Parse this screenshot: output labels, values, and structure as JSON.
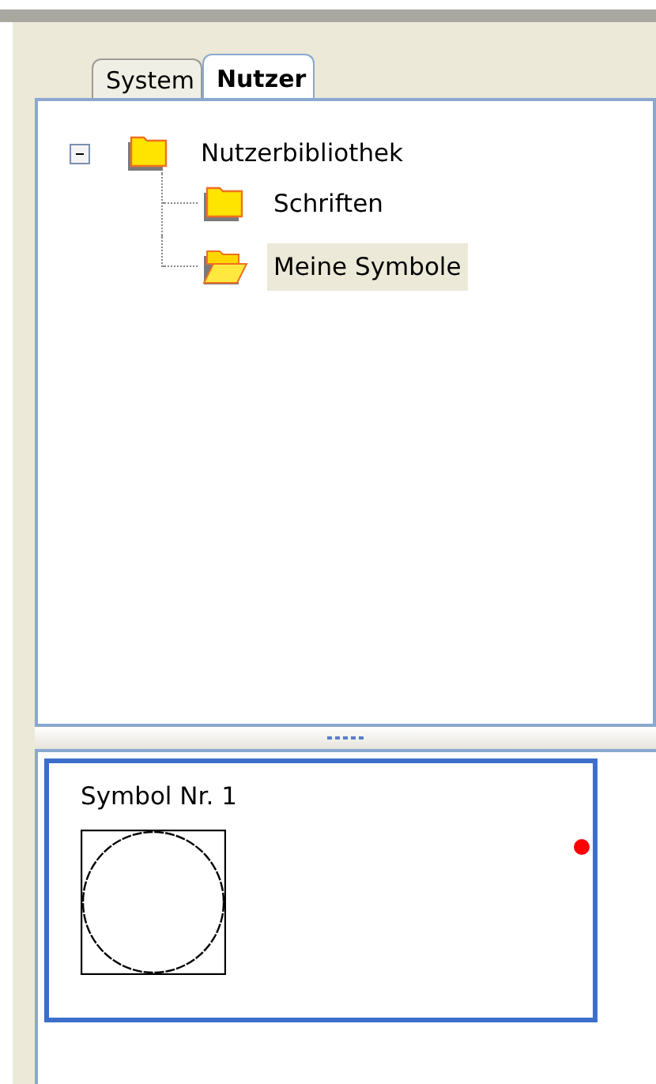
{
  "tabs": [
    {
      "label": "System",
      "selected": false
    },
    {
      "label": "Nutzer",
      "selected": true
    }
  ],
  "tree": [
    {
      "label": "Nutzerbibliothek",
      "expanded": true,
      "selected": false,
      "children": [
        {
          "label": "Schriften",
          "selected": false
        },
        {
          "label": "Meine Symbole",
          "selected": true
        }
      ]
    }
  ],
  "symbols": [
    {
      "label": "Symbol Nr. 1",
      "selected": true
    }
  ]
}
